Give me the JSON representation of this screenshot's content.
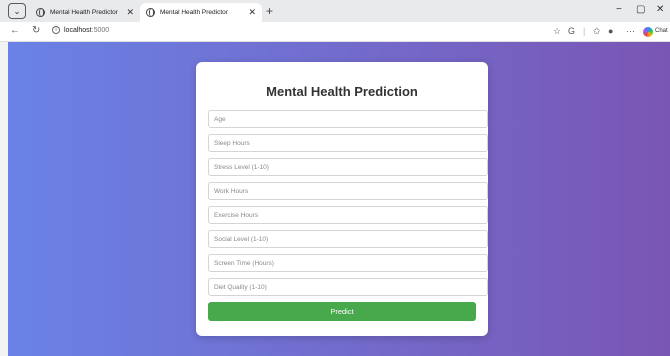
{
  "browser": {
    "tabs": [
      {
        "title": "Mental Health Predictor",
        "active": false
      },
      {
        "title": "Mental Health Predictor",
        "active": true
      }
    ],
    "url": {
      "host": "localhost",
      "port": ":5000"
    },
    "chat_label": "Chat"
  },
  "form": {
    "title": "Mental Health Prediction",
    "fields": [
      {
        "placeholder": "Age"
      },
      {
        "placeholder": "Sleep Hours"
      },
      {
        "placeholder": "Stress Level (1-10)"
      },
      {
        "placeholder": "Work Hours"
      },
      {
        "placeholder": "Exercise Hours"
      },
      {
        "placeholder": "Social Level (1-10)"
      },
      {
        "placeholder": "Screen Time (Hours)"
      },
      {
        "placeholder": "Diet Quality (1-10)"
      }
    ],
    "submit_label": "Predict"
  },
  "colors": {
    "gradient_start": "#6a82e6",
    "gradient_end": "#7a56b4",
    "button": "#48a84c"
  }
}
